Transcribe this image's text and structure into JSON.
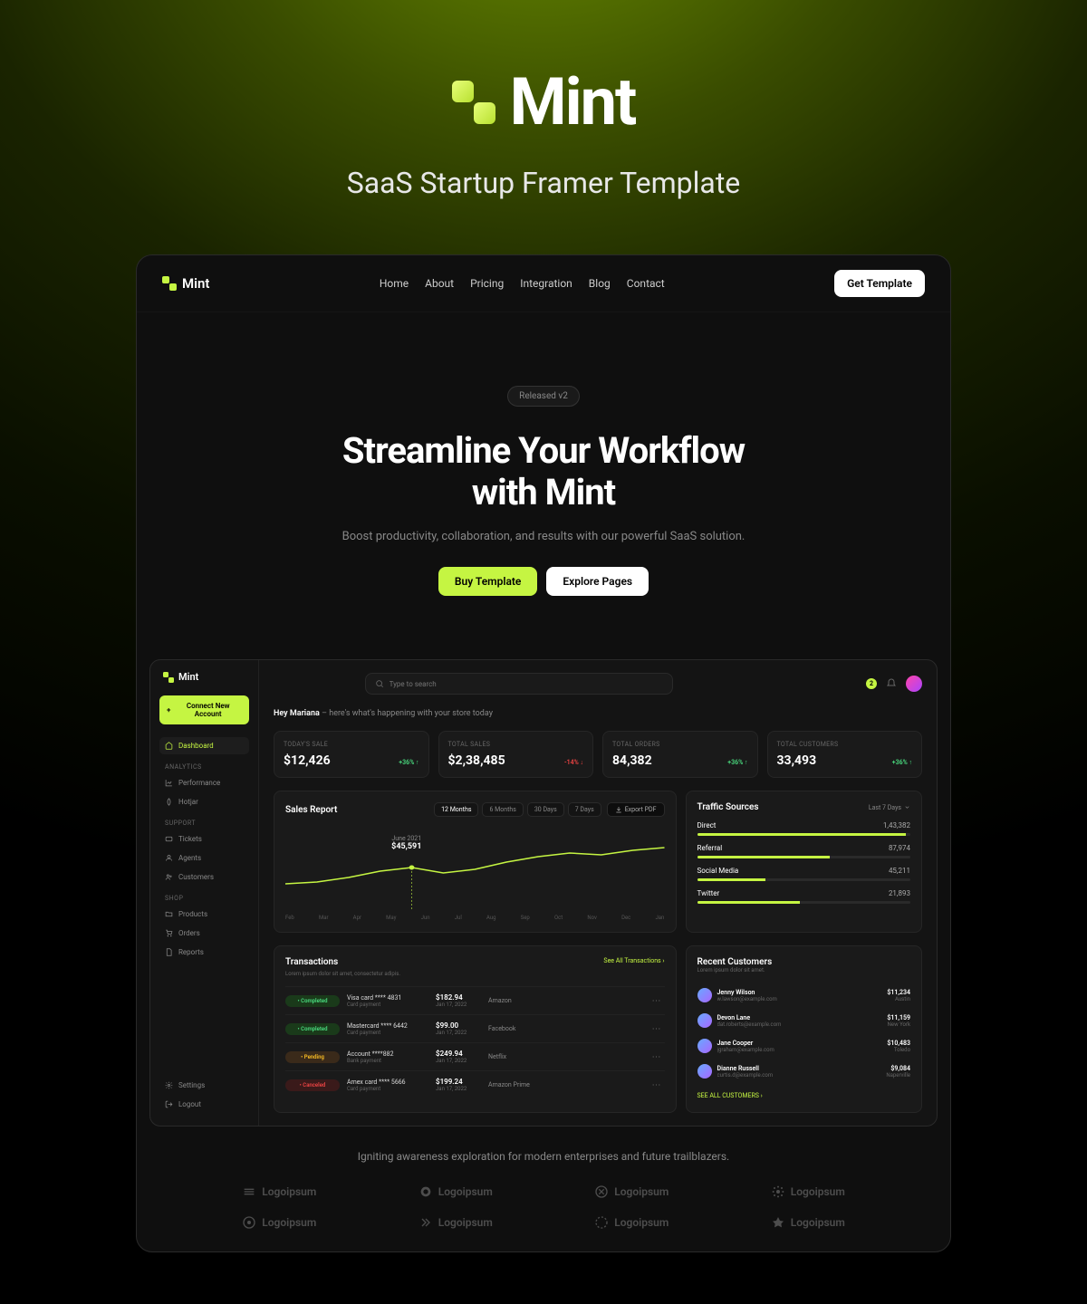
{
  "hero": {
    "brand": "Mint",
    "subtitle": "SaaS Startup Framer Template"
  },
  "nav": {
    "brand": "Mint",
    "links": [
      "Home",
      "About",
      "Pricing",
      "Integration",
      "Blog",
      "Contact"
    ],
    "cta": "Get Template"
  },
  "landing": {
    "badge": "Released v2",
    "title_l1": "Streamline Your Workflow",
    "title_l2": "with Mint",
    "desc": "Boost productivity, collaboration, and results with our powerful SaaS solution.",
    "btn1": "Buy Template",
    "btn2": "Explore Pages"
  },
  "sidebar": {
    "brand": "Mint",
    "connect": "Connect New Account",
    "items": [
      {
        "label": "Dashboard",
        "active": true
      }
    ],
    "section_analytics": "ANALYTICS",
    "analytics": [
      "Performance",
      "Hotjar"
    ],
    "section_support": "SUPPORT",
    "support": [
      "Tickets",
      "Agents",
      "Customers"
    ],
    "section_shop": "SHOP",
    "shop": [
      "Products",
      "Orders",
      "Reports"
    ],
    "bottom": [
      "Settings",
      "Logout"
    ]
  },
  "topbar": {
    "search_placeholder": "Type to search",
    "notif": "2"
  },
  "greeting": {
    "name": "Hey Mariana",
    "tail": " – here's what's happening with your store today"
  },
  "stats": [
    {
      "label": "TODAY'S SALE",
      "value": "$12,426",
      "delta": "+36% ↑",
      "dir": "up"
    },
    {
      "label": "TOTAL SALES",
      "value": "$2,38,485",
      "delta": "-14% ↓",
      "dir": "down"
    },
    {
      "label": "TOTAL ORDERS",
      "value": "84,382",
      "delta": "+36% ↑",
      "dir": "up"
    },
    {
      "label": "TOTAL CUSTOMERS",
      "value": "33,493",
      "delta": "+36% ↑",
      "dir": "up"
    }
  ],
  "sales": {
    "title": "Sales Report",
    "ranges": [
      "12 Months",
      "6 Months",
      "30 Days",
      "7 Days"
    ],
    "active_range": 0,
    "export": "Export PDF",
    "tip_month": "June 2021",
    "tip_val": "$45,591",
    "months": [
      "Feb",
      "Mar",
      "Apr",
      "May",
      "Jun",
      "Jul",
      "Aug",
      "Sep",
      "Oct",
      "Nov",
      "Dec",
      "Jan"
    ]
  },
  "traffic": {
    "title": "Traffic Sources",
    "period": "Last 7 Days",
    "items": [
      {
        "name": "Direct",
        "value": "1,43,382",
        "pct": 98
      },
      {
        "name": "Referral",
        "value": "87,974",
        "pct": 62
      },
      {
        "name": "Social Media",
        "value": "45,211",
        "pct": 32
      },
      {
        "name": "Twitter",
        "value": "21,893",
        "pct": 48
      }
    ]
  },
  "tx": {
    "title": "Transactions",
    "link": "See All Transactions ›",
    "sub": "Lorem ipsum dolor sit amet, consectetur adipis.",
    "rows": [
      {
        "status": "Completed",
        "cls": "completed",
        "card": "Visa card **** 4831",
        "method": "Card payment",
        "amount": "$182.94",
        "date": "Jan 17, 2022",
        "merchant": "Amazon"
      },
      {
        "status": "Completed",
        "cls": "completed",
        "card": "Mastercard **** 6442",
        "method": "Card payment",
        "amount": "$99.00",
        "date": "Jan 17, 2022",
        "merchant": "Facebook"
      },
      {
        "status": "Pending",
        "cls": "pending",
        "card": "Account ****882",
        "method": "Bank payment",
        "amount": "$249.94",
        "date": "Jan 17, 2022",
        "merchant": "Netflix"
      },
      {
        "status": "Canceled",
        "cls": "canceled",
        "card": "Amex card **** 5666",
        "method": "Card payment",
        "amount": "$199.24",
        "date": "Jan 17, 2022",
        "merchant": "Amazon Prime"
      }
    ]
  },
  "customers": {
    "title": "Recent Customers",
    "sub": "Lorem ipsum dolor sit amet.",
    "link": "SEE ALL CUSTOMERS ›",
    "rows": [
      {
        "name": "Jenny Wilson",
        "email": "w.lawson@example.com",
        "amount": "$11,234",
        "loc": "Austin"
      },
      {
        "name": "Devon Lane",
        "email": "dat.roberts@example.com",
        "amount": "$11,159",
        "loc": "New York"
      },
      {
        "name": "Jane Cooper",
        "email": "jgraham@example.com",
        "amount": "$10,483",
        "loc": "Toledo"
      },
      {
        "name": "Dianne Russell",
        "email": "curtis.d@example.com",
        "amount": "$9,084",
        "loc": "Naperville"
      }
    ]
  },
  "tagline": "Igniting awareness exploration for modern enterprises and future trailblazers.",
  "footer_logos": [
    "Logoipsum",
    "Logoipsum",
    "Logoipsum",
    "Logoipsum",
    "Logoipsum",
    "Logoipsum",
    "Logoipsum",
    "Logoipsum"
  ],
  "chart_data": {
    "type": "line",
    "title": "Sales Report",
    "x": [
      "Feb",
      "Mar",
      "Apr",
      "May",
      "Jun",
      "Jul",
      "Aug",
      "Sep",
      "Oct",
      "Nov",
      "Dec",
      "Jan"
    ],
    "series": [
      {
        "name": "Sales",
        "values": [
          30,
          32,
          36,
          42,
          45.6,
          40,
          44,
          50,
          55,
          58,
          56,
          60
        ]
      }
    ],
    "highlight": {
      "x": "Jun",
      "label": "June 2021",
      "value": 45591
    },
    "ylabel": "",
    "xlabel": "",
    "ylim": [
      20,
      65
    ]
  }
}
